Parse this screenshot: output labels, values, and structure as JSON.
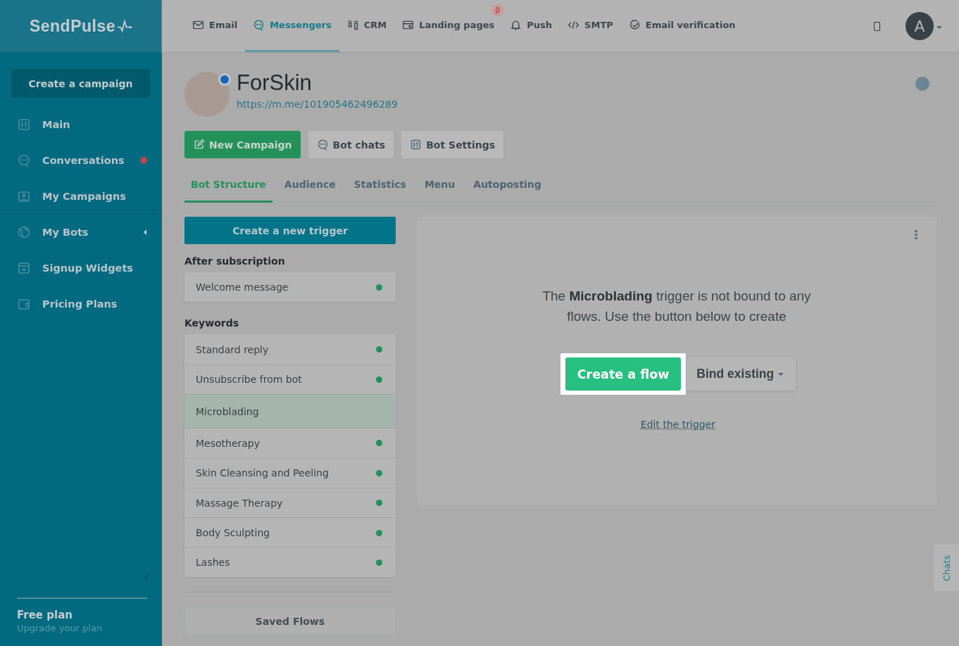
{
  "logo": {
    "text": "SendPulse"
  },
  "top_nav": [
    {
      "label": "Email",
      "selected": false
    },
    {
      "label": "Messengers",
      "selected": true
    },
    {
      "label": "CRM",
      "selected": false
    },
    {
      "label": "Landing pages",
      "selected": false,
      "badge": "β"
    },
    {
      "label": "Push",
      "selected": false
    },
    {
      "label": "SMTP",
      "selected": false
    },
    {
      "label": "Email verification",
      "selected": false
    }
  ],
  "user": {
    "avatar": "A"
  },
  "sidebar": {
    "create_button": "Create a campaign",
    "items": [
      {
        "label": "Main",
        "notification": false,
        "submenu": false
      },
      {
        "label": "Conversations",
        "notification": true,
        "submenu": false
      },
      {
        "label": "My Campaigns",
        "notification": false,
        "submenu": false
      },
      {
        "label": "My Bots",
        "notification": false,
        "submenu": true
      },
      {
        "label": "Signup Widgets",
        "notification": false,
        "submenu": false
      },
      {
        "label": "Pricing Plans",
        "notification": false,
        "submenu": false
      }
    ],
    "plan": {
      "title": "Free plan",
      "link": "Upgrade your plan"
    }
  },
  "bot": {
    "name": "ForSkin",
    "link": "https://m.me/101905462496289",
    "actions": [
      {
        "label": "New Campaign",
        "kind": "primary"
      },
      {
        "label": "Bot chats",
        "kind": "secondary"
      },
      {
        "label": "Bot Settings",
        "kind": "secondary"
      }
    ],
    "tabs": [
      {
        "label": "Bot Structure",
        "selected": true
      },
      {
        "label": "Audience",
        "selected": false
      },
      {
        "label": "Statistics",
        "selected": false
      },
      {
        "label": "Menu",
        "selected": false
      },
      {
        "label": "Autoposting",
        "selected": false
      }
    ]
  },
  "triggers": {
    "create_button": "Create a new trigger",
    "groups": [
      {
        "title": "After subscription",
        "items": [
          {
            "label": "Welcome message",
            "selected": false,
            "active": true
          }
        ]
      },
      {
        "title": "Keywords",
        "items": [
          {
            "label": "Standard reply",
            "selected": false,
            "active": true
          },
          {
            "label": "Unsubscribe from bot",
            "selected": false,
            "active": true
          },
          {
            "label": "Microblading",
            "selected": true,
            "active": false
          },
          {
            "label": "Mesotherapy",
            "selected": false,
            "active": true
          },
          {
            "label": "Skin Cleansing and Peeling",
            "selected": false,
            "active": true
          },
          {
            "label": "Massage Therapy",
            "selected": false,
            "active": true
          },
          {
            "label": "Body Sculpting",
            "selected": false,
            "active": true
          },
          {
            "label": "Lashes",
            "selected": false,
            "active": true
          }
        ]
      }
    ],
    "saved_flows_button": "Saved Flows"
  },
  "panel": {
    "message": "The **Microblading** trigger is not bound to any flows. Use the button below to create",
    "create_button": "Create a flow",
    "bind_button": "Bind existing",
    "edit_link": "Edit the trigger"
  },
  "chats_tab": "Chats"
}
